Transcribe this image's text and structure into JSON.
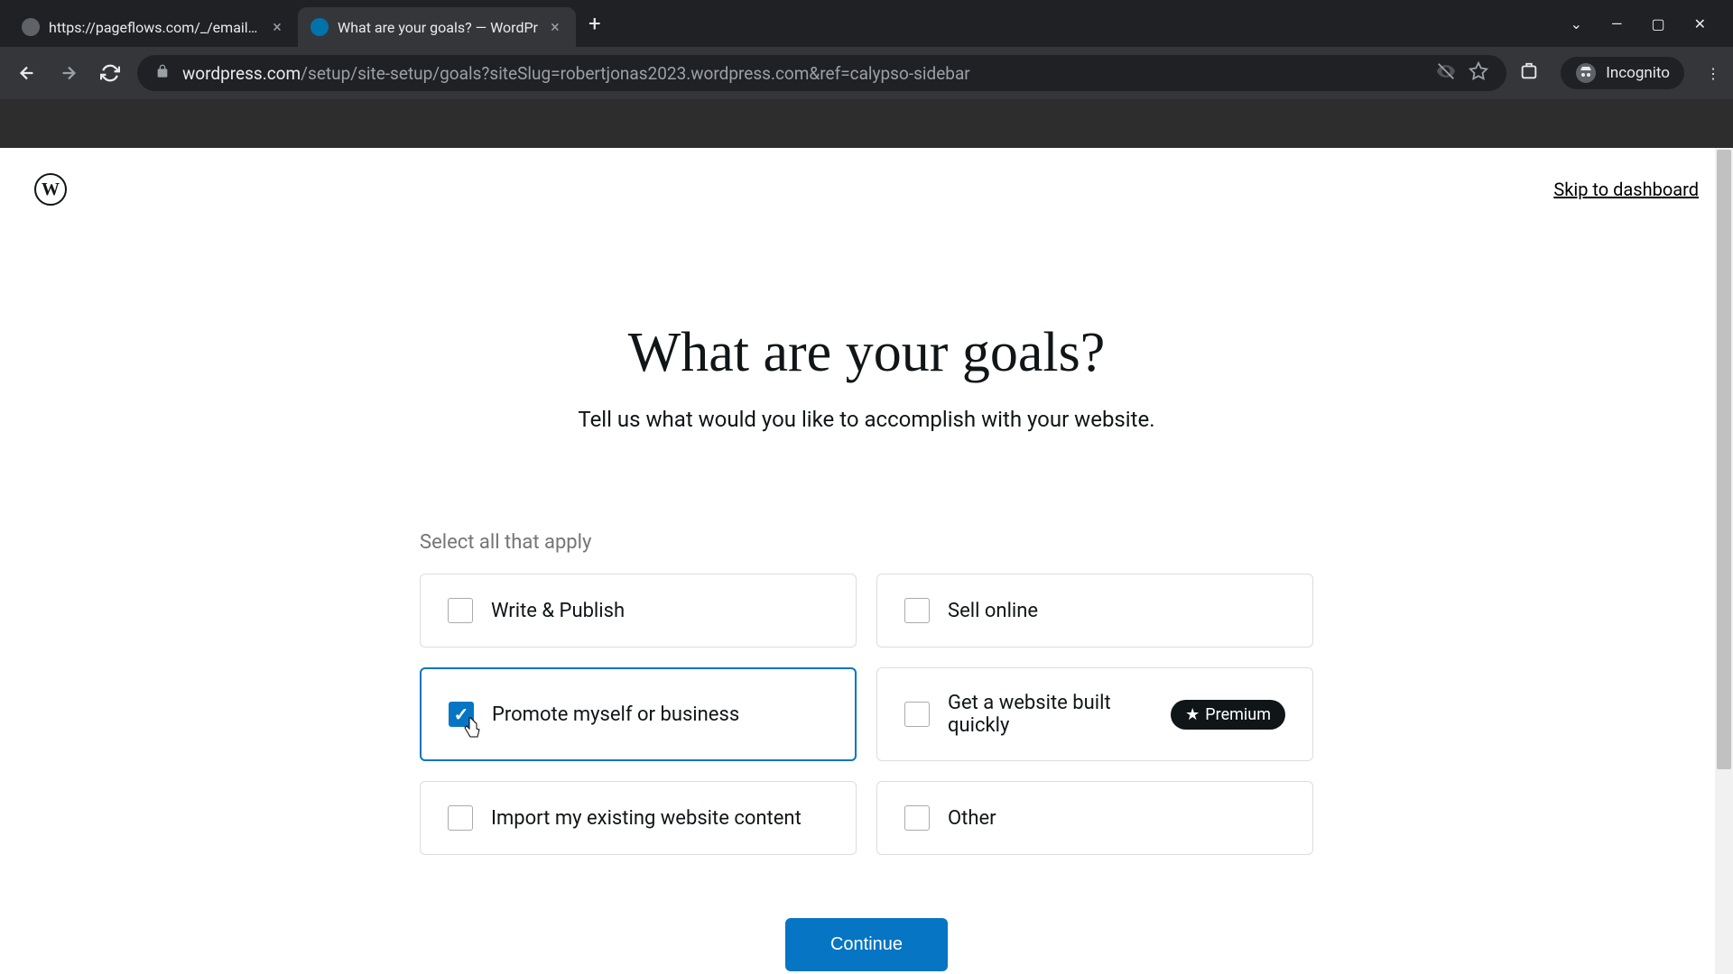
{
  "browser": {
    "tabs": [
      {
        "title": "https://pageflows.com/_/emails/",
        "active": false
      },
      {
        "title": "What are your goals? — WordPr",
        "active": true
      }
    ],
    "url_domain": "wordpress.com",
    "url_path": "/setup/site-setup/goals?siteSlug=robertjonas2023.wordpress.com&ref=calypso-sidebar",
    "incognito_label": "Incognito"
  },
  "page": {
    "skip_link": "Skip to dashboard",
    "heading": "What are your goals?",
    "subheading": "Tell us what would you like to accomplish with your website.",
    "select_hint": "Select all that apply",
    "options": [
      {
        "label": "Write & Publish",
        "checked": false,
        "premium": false
      },
      {
        "label": "Sell online",
        "checked": false,
        "premium": false
      },
      {
        "label": "Promote myself or business",
        "checked": true,
        "premium": false
      },
      {
        "label": "Get a website built quickly",
        "checked": false,
        "premium": true
      },
      {
        "label": "Import my existing website content",
        "checked": false,
        "premium": false
      },
      {
        "label": "Other",
        "checked": false,
        "premium": false
      }
    ],
    "premium_badge": "Premium",
    "continue_label": "Continue"
  }
}
